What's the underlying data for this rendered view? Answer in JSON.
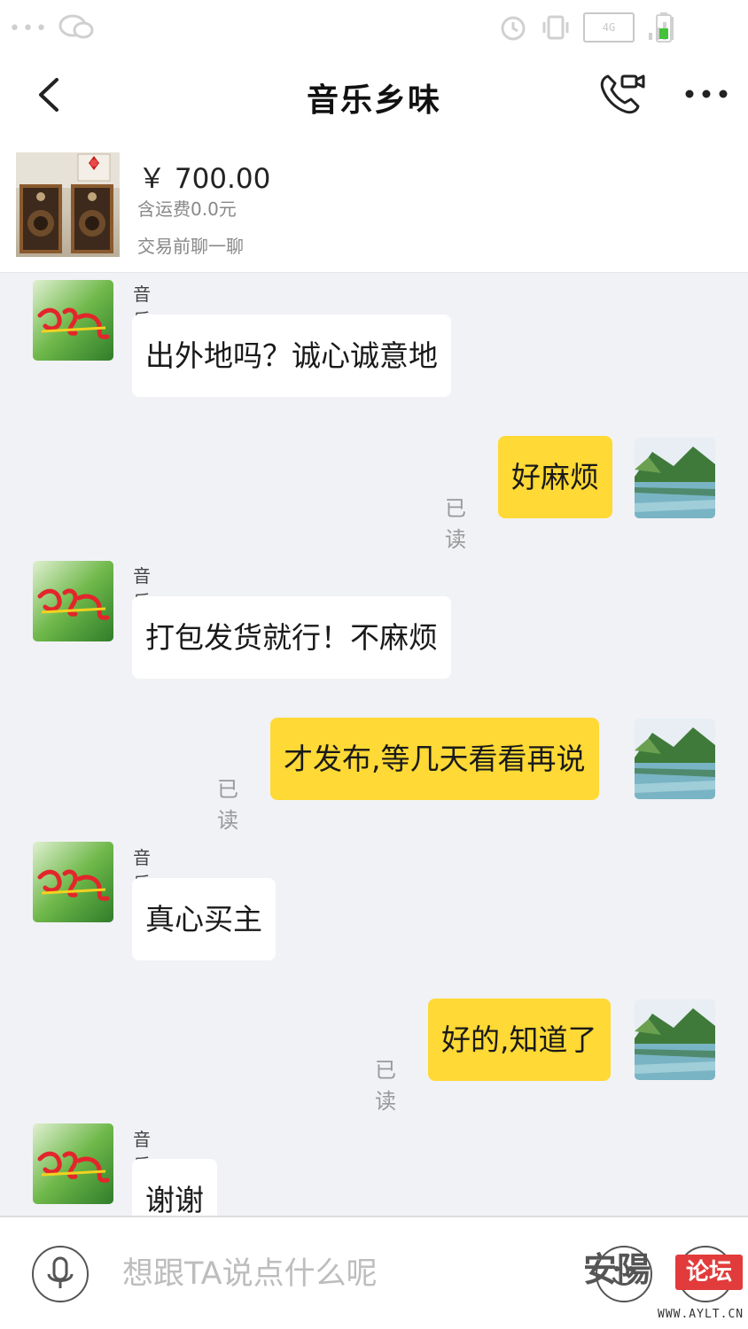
{
  "status_bar": {
    "network": "4G",
    "icons": [
      "more-dots-icon",
      "wechat-icon",
      "alarm-icon",
      "vibrate-icon",
      "signal-icon",
      "battery-icon"
    ]
  },
  "header": {
    "title": "音乐乡味",
    "back_icon": "chevron-left-icon",
    "call_icon": "phone-video-icon",
    "more_icon": "more-dots-icon"
  },
  "product": {
    "price": "￥ 700.00",
    "shipping": "含运费0.0元",
    "note": "交易前聊一聊"
  },
  "messages": [
    {
      "direction": "in",
      "sender": "音乐乡味",
      "text": "出外地吗？诚心诚意地"
    },
    {
      "direction": "out",
      "text": "好麻烦",
      "status": "已读"
    },
    {
      "direction": "in",
      "sender": "音乐乡味",
      "text": "打包发货就行！不麻烦"
    },
    {
      "direction": "out",
      "text": "才发布,等几天看看再说",
      "status": "已读"
    },
    {
      "direction": "in",
      "sender": "音乐乡味",
      "text": "真心买主"
    },
    {
      "direction": "out",
      "text": "好的,知道了",
      "status": "已读"
    },
    {
      "direction": "in",
      "sender": "音乐乡味",
      "text": "谢谢"
    }
  ],
  "input_bar": {
    "placeholder": "想跟TA说点什么呢",
    "mic_icon": "microphone-icon",
    "emoji_icon": "emoji-icon",
    "plus_icon": "plus-icon"
  },
  "watermark": {
    "logo": "安陽",
    "badge": "论坛",
    "url": "WWW.AYLT.CN"
  },
  "colors": {
    "outgoing_bubble": "#ffd935",
    "incoming_bubble": "#ffffff",
    "chat_background": "#f1f2f6"
  }
}
